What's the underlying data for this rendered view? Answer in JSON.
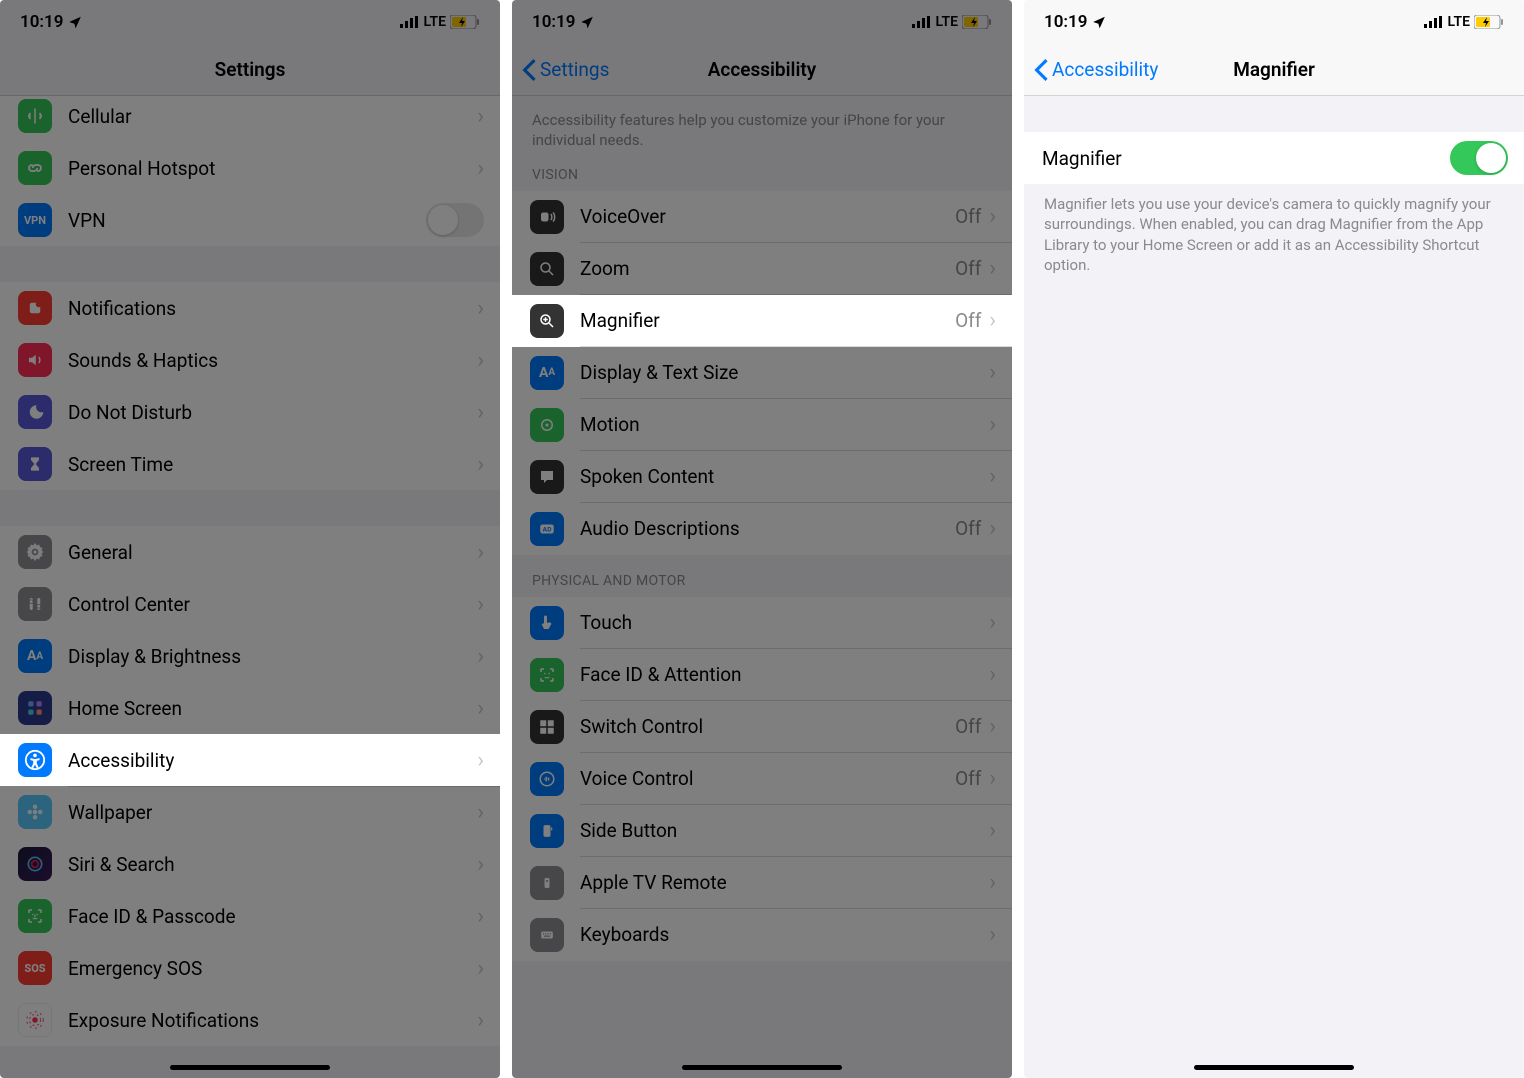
{
  "status": {
    "time": "10:19",
    "carrier": "LTE"
  },
  "screen1": {
    "title": "Settings",
    "rows": {
      "cellular": "Cellular",
      "hotspot": "Personal Hotspot",
      "vpn": "VPN",
      "notifications": "Notifications",
      "sounds": "Sounds & Haptics",
      "dnd": "Do Not Disturb",
      "screentime": "Screen Time",
      "general": "General",
      "controlcenter": "Control Center",
      "display": "Display & Brightness",
      "homescreen": "Home Screen",
      "accessibility": "Accessibility",
      "wallpaper": "Wallpaper",
      "siri": "Siri & Search",
      "faceid": "Face ID & Passcode",
      "sos": "Emergency SOS",
      "exposure": "Exposure Notifications"
    }
  },
  "screen2": {
    "back": "Settings",
    "title": "Accessibility",
    "intro": "Accessibility features help you customize your iPhone for your individual needs.",
    "section_vision": "VISION",
    "section_physical": "PHYSICAL AND MOTOR",
    "off": "Off",
    "rows": {
      "voiceover": "VoiceOver",
      "zoom": "Zoom",
      "magnifier": "Magnifier",
      "displaytext": "Display & Text Size",
      "motion": "Motion",
      "spoken": "Spoken Content",
      "audio": "Audio Descriptions",
      "touch": "Touch",
      "face": "Face ID & Attention",
      "switchc": "Switch Control",
      "voicec": "Voice Control",
      "sidebtn": "Side Button",
      "atv": "Apple TV Remote",
      "keyboards": "Keyboards"
    }
  },
  "screen3": {
    "back": "Accessibility",
    "title": "Magnifier",
    "toggle_label": "Magnifier",
    "description": "Magnifier lets you use your device's camera to quickly magnify your surroundings. When enabled, you can drag Magnifier from the App Library to your Home Screen or add it as an Accessibility Shortcut option."
  },
  "colors": {
    "green": "#34c759",
    "red": "#ff3b30",
    "blue": "#007aff",
    "orange": "#ff9500",
    "gray": "#8e8e93",
    "purple": "#5856d6",
    "darkgray": "#444"
  }
}
